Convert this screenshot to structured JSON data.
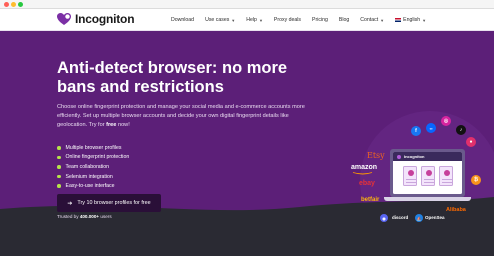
{
  "nav": {
    "logo_text": "Incogniton",
    "items": [
      {
        "label": "Download",
        "dropdown": false
      },
      {
        "label": "Use cases",
        "dropdown": true
      },
      {
        "label": "Help",
        "dropdown": true
      },
      {
        "label": "Proxy deals",
        "dropdown": false
      },
      {
        "label": "Pricing",
        "dropdown": false
      },
      {
        "label": "Blog",
        "dropdown": false
      },
      {
        "label": "Contact",
        "dropdown": true
      }
    ],
    "language": "English"
  },
  "hero": {
    "title_line1": "Anti-detect browser: no more",
    "title_line2": "bans and restrictions",
    "description_pre": "Choose online fingerprint protection and manage your social media and e-commerce accounts more efficiently. Set up multiple browser accounts and decide your own digital fingerprint details like geolocation. Try for ",
    "description_bold": "free",
    "description_post": " now!",
    "features": [
      "Multiple browser profiles",
      "Online fingerprint protection",
      "Team collaboration",
      "Selenium integration",
      "Easy-to-use interface"
    ],
    "cta_label": "Try 10 browser profiles for free",
    "trusted_pre": "Trusted by ",
    "trusted_bold": "400.000+",
    "trusted_post": " users"
  },
  "illustration": {
    "screen_app_name": "Incogniton",
    "brands": {
      "etsy": "Etsy",
      "amazon": "amazon",
      "ebay": "ebay",
      "betfair": "betfair",
      "discord": "discord",
      "opensea": "OpenSea",
      "alibaba": "Alibaba"
    }
  },
  "colors": {
    "hero_bg": "#5c1f78",
    "cta_bg": "#2a0f38",
    "check": "#b7e34a",
    "footer_band": "#2a2a33"
  }
}
